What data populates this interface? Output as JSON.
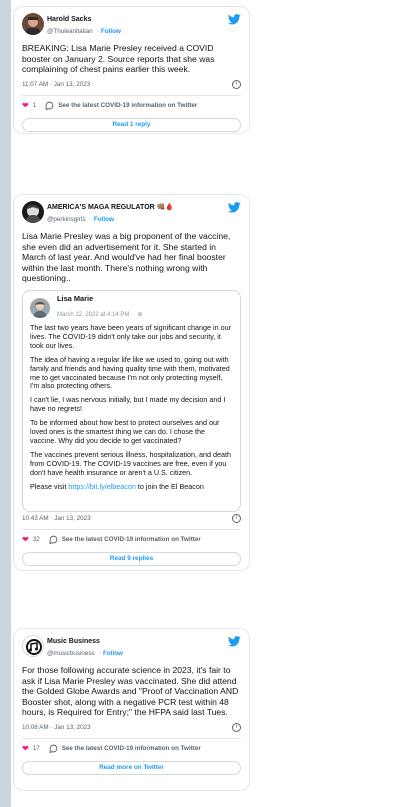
{
  "colors": {
    "link": "#1d9bf0",
    "heart": "#f91880",
    "muted": "#536471",
    "border": "#e1e8ed"
  },
  "tweets": [
    {
      "name": "Harold Sacks",
      "handle": "@Thuleanltalian",
      "follow": "Follow",
      "text": "BREAKING: Lisa Marie Presley received a COVID booster on January 2. Source reports that she was complaining of chest pains earlier this week.",
      "timestamp": "11:07 AM · Jan 13, 2023",
      "likes": "1",
      "covid_link": "See the latest COVID-19 information on Twitter",
      "read_button": "Read 1 reply"
    },
    {
      "name": "AMERICA'S MAGA REGULATOR",
      "name_emoji": "👊🏽🩸",
      "handle": "@perkinsgirl1",
      "follow": "Follow",
      "text": "Lisa Marie Presley was a big proponent of the vaccine, she even did an advertisement for it. She started in March of last year. And would've had her final booster within the last month. There's nothing wrong with questioning..",
      "timestamp": "10:43 AM · Jan 13, 2023",
      "likes": "32",
      "covid_link": "See the latest COVID-19 information on Twitter",
      "read_button": "Read 9 replies",
      "quote": {
        "name": "Lisa Marie",
        "date": "March 12, 2022 at 4:14 PM ·",
        "paragraphs": [
          "The last two years have been years of significant change in our lives. The COVID-19 didn't only take our jobs and security, it took our lives.",
          "The idea of having a regular life like we used to, going out with family and friends and having quality time with them, motivated me to get vaccinated because I'm not only protecting myself, I'm also protecting others.",
          "I can't lie, I was nervous initially, but I made my decision and I have no regrets!",
          "To be informed about how best to protect ourselves and our loved ones is the smartest thing we can do. I chose the vaccine. Why did you decide to get vaccinated?",
          "The vaccines prevent serious illness, hospitalization, and death from COVID-19. The COVID-19 vaccines are free, even if you don't have health insurance or aren't a U.S. citizen."
        ],
        "last_prefix": "Please visit ",
        "last_link": "https://bit.ly/elbeacon",
        "last_suffix": " to join the El Beacon"
      }
    },
    {
      "name": "Music Business",
      "handle": "@musicbusiness",
      "follow": "Follow",
      "text": "For those following accurate science in 2023, it's fair to ask if Lisa Marie Presley was vaccinated. She did attend the Golded Globe Awards and \"Proof of Vaccination AND Booster shot, along with a negative PCR test within 48 hours, is Required for Entry;\" the HFPA said last Tues.",
      "timestamp": "10:08 AM · Jan 13, 2023",
      "likes": "17",
      "covid_link": "See the latest COVID-19 information on Twitter",
      "read_button": "Read more on Twitter"
    }
  ]
}
